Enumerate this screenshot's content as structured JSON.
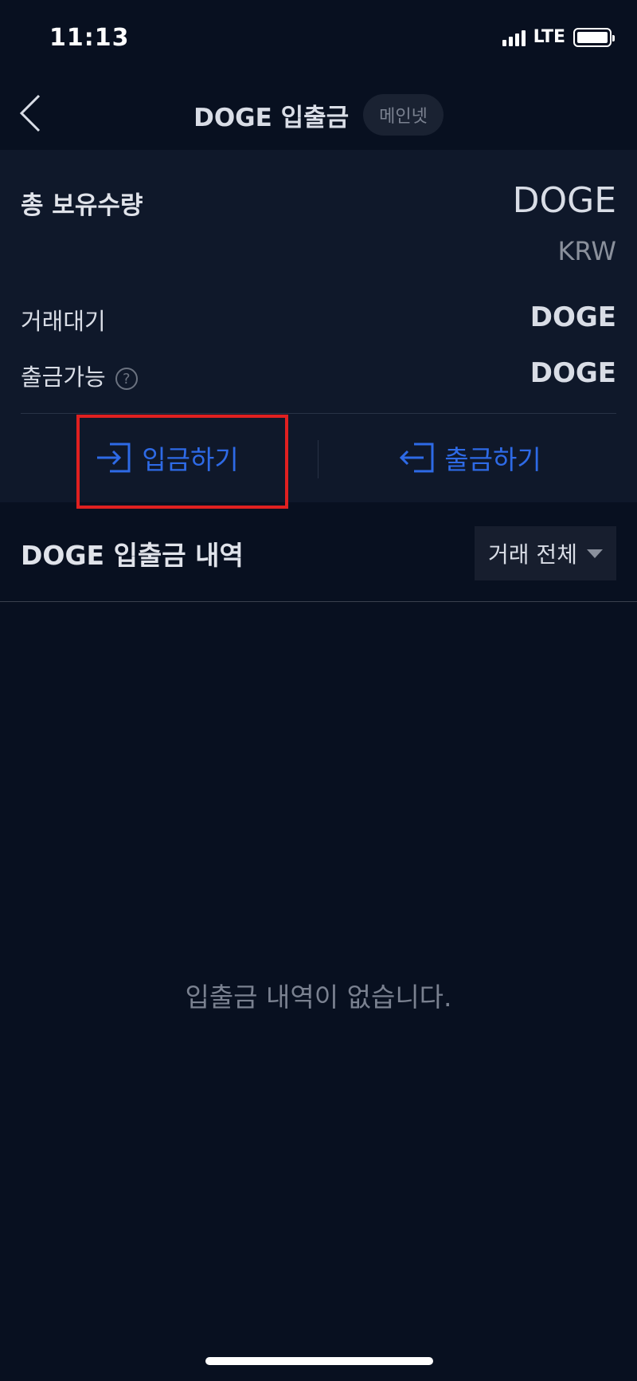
{
  "status_bar": {
    "time": "11:13",
    "network": "LTE"
  },
  "header": {
    "title": "DOGE 입출금",
    "network_badge": "메인넷",
    "back_icon": "chevron-left-icon"
  },
  "balance": {
    "total_label": "총 보유수량",
    "total_coin": "DOGE",
    "total_krw": "KRW",
    "pending_label": "거래대기",
    "pending_value": "DOGE",
    "available_label": "출금가능",
    "available_value": "DOGE",
    "help_icon": "question-circle-icon"
  },
  "actions": {
    "deposit_label": "입금하기",
    "deposit_icon": "enter-icon",
    "withdraw_label": "출금하기",
    "withdraw_icon": "exit-icon",
    "highlighted": "deposit"
  },
  "history": {
    "title": "DOGE 입출금 내역",
    "filter_selected": "거래 전체",
    "empty_message": "입출금 내역이 없습니다."
  },
  "colors": {
    "background": "#081020",
    "panel": "#0f182a",
    "accent": "#2e6ae6",
    "highlight": "#e02020"
  }
}
